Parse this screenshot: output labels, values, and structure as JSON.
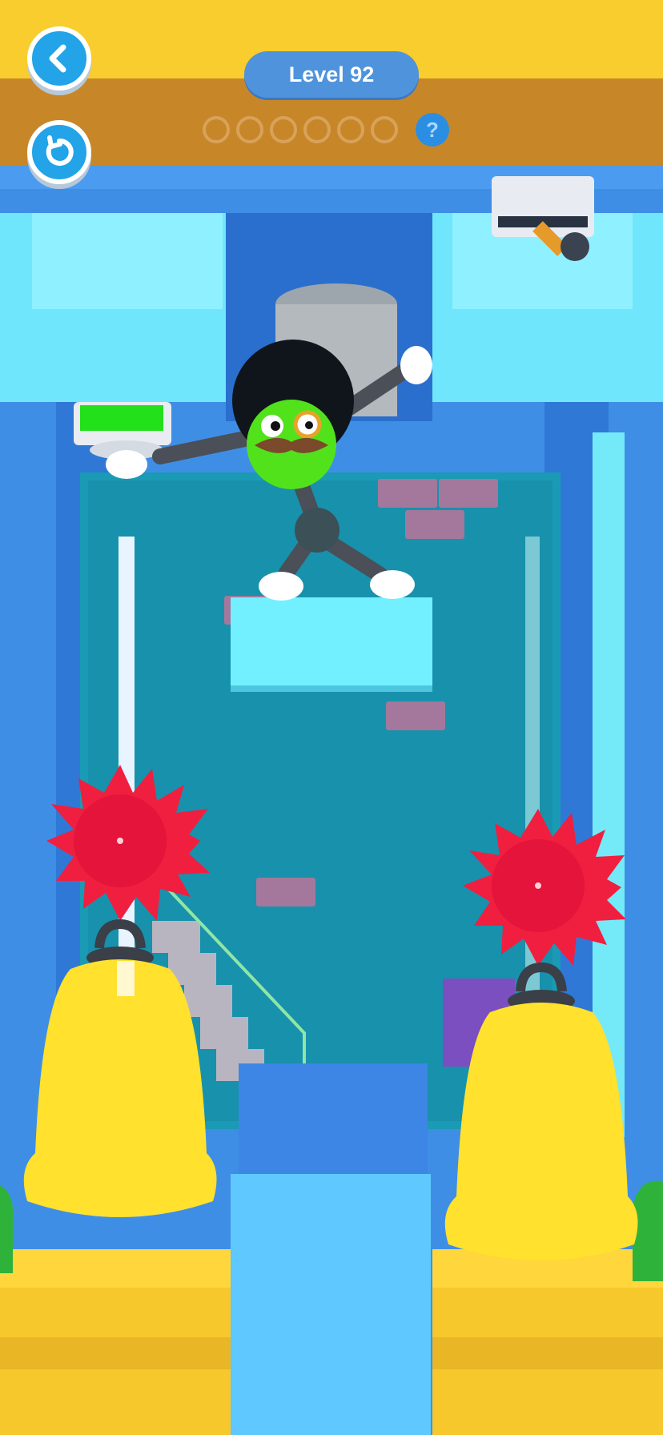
{
  "hud": {
    "level_label": "Level 92",
    "progress_total": 6,
    "progress_filled": 0,
    "back_icon": "chevron-left-icon",
    "restart_icon": "restart-icon",
    "help_label": "?"
  },
  "colors": {
    "hud_top": "#f9cd2d",
    "hud_band": "#c78729",
    "button_blue": "#23a3e8",
    "wall_blue": "#3f8ee6",
    "cyan_block": "#6fe6fb",
    "pit_teal": "#1a9ab4",
    "saw_red": "#f01f3f",
    "bell_yellow": "#ffe12e",
    "green_switch": "#22e01a"
  }
}
